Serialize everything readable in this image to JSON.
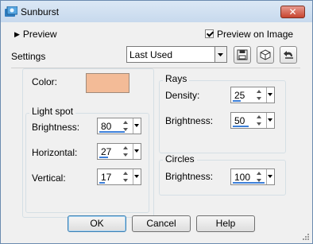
{
  "window": {
    "title": "Sunburst",
    "close_label": "✕"
  },
  "preview": {
    "label": "Preview",
    "on_image_label": "Preview on Image",
    "on_image_checked": true
  },
  "settings": {
    "label": "Settings",
    "preset_value": "Last Used"
  },
  "toolbar": {
    "icons": [
      "save-preset-icon",
      "reset-icon",
      "undo-icon"
    ]
  },
  "color": {
    "label": "Color:",
    "value": "#f3bb97"
  },
  "light_spot": {
    "title": "Light spot",
    "brightness": {
      "label": "Brightness:",
      "value": "80",
      "level": 0.8
    },
    "horizontal": {
      "label": "Horizontal:",
      "value": "27",
      "level": 0.27
    },
    "vertical": {
      "label": "Vertical:",
      "value": "17",
      "level": 0.17
    }
  },
  "rays": {
    "title": "Rays",
    "density": {
      "label": "Density:",
      "value": "25",
      "level": 0.25
    },
    "brightness": {
      "label": "Brightness:",
      "value": "50",
      "level": 0.5
    }
  },
  "circles": {
    "title": "Circles",
    "brightness": {
      "label": "Brightness:",
      "value": "100",
      "level": 1.0
    }
  },
  "buttons": {
    "ok": "OK",
    "cancel": "Cancel",
    "help": "Help"
  }
}
